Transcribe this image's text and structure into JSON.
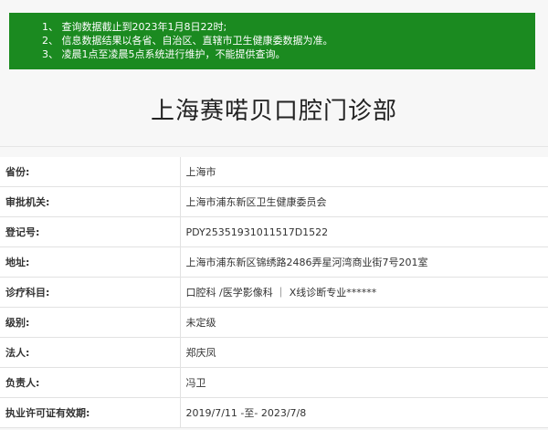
{
  "notice": {
    "lines": [
      "1、 查询数据截止到2023年1月8日22时;",
      "2、 信息数据结果以各省、自治区、直辖市卫生健康委数据为准。",
      "3、 凌晨1点至凌晨5点系统进行维护，不能提供查询。"
    ]
  },
  "title": "上海赛喏贝口腔门诊部",
  "rows": [
    {
      "label": "省份:",
      "value": "上海市"
    },
    {
      "label": "审批机关:",
      "value": "上海市浦东新区卫生健康委员会"
    },
    {
      "label": "登记号:",
      "value": "PDY25351931011517D1522"
    },
    {
      "label": "地址:",
      "value": "上海市浦东新区锦绣路2486弄星河湾商业街7号201室"
    },
    {
      "label": "诊疗科目:",
      "value": "口腔科 /医学影像科 ｜ X线诊断专业******"
    },
    {
      "label": "级别:",
      "value": "未定级"
    },
    {
      "label": "法人:",
      "value": "郑庆凤"
    },
    {
      "label": "负责人:",
      "value": "冯卫"
    },
    {
      "label": "执业许可证有效期:",
      "value": "2019/7/11 -至- 2023/7/8"
    }
  ]
}
